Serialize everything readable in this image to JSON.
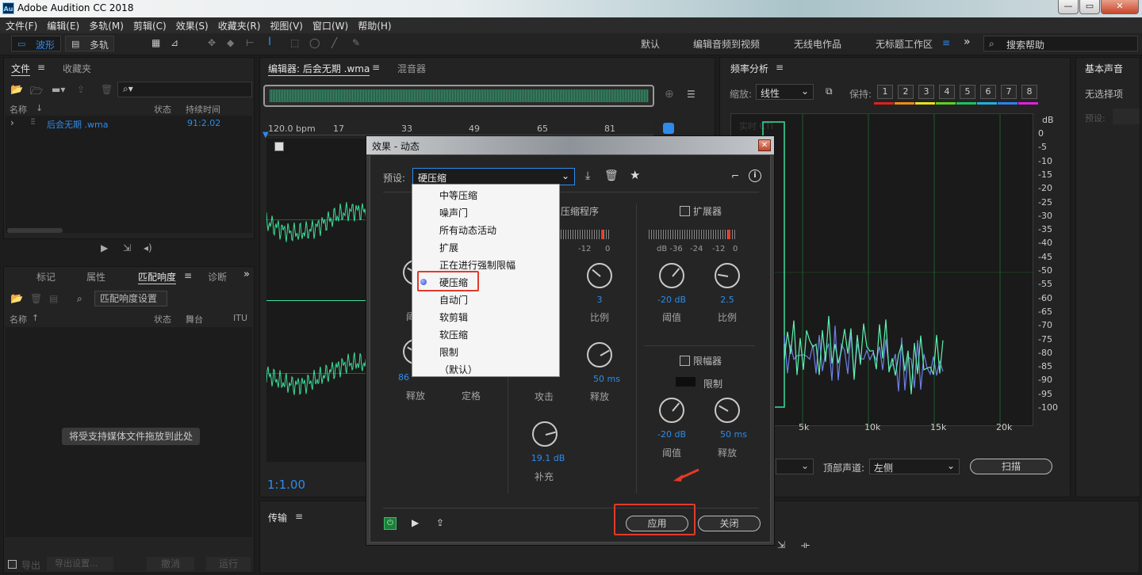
{
  "app": {
    "title": "Adobe Audition CC 2018",
    "logo": "Au"
  },
  "menu": [
    "文件(F)",
    "编辑(E)",
    "多轨(M)",
    "剪辑(C)",
    "效果(S)",
    "收藏夹(R)",
    "视图(V)",
    "窗口(W)",
    "帮助(H)"
  ],
  "toolbar": {
    "waveform": "波形",
    "multitrack": "多轨"
  },
  "workspaces": {
    "default": "默认",
    "edit_video": "编辑音频到视频",
    "radio": "无线电作品",
    "untitled": "无标题工作区",
    "more": "»",
    "search_placeholder": "搜索帮助"
  },
  "files_panel": {
    "tab_files": "文件",
    "tab_favorites": "收藏夹",
    "col_name": "名称",
    "col_status": "状态",
    "col_duration": "持续时间",
    "file_name": "后会无期 .wma",
    "file_duration": "91:2.02"
  },
  "markers_panel": {
    "tab_markers": "标记",
    "tab_props": "属性",
    "tab_match": "匹配响度",
    "tab_diag": "诊断",
    "match_settings": "匹配响度设置",
    "col_name": "名称",
    "col_status": "状态",
    "col_stage": "舞台",
    "col_itu": "ITU",
    "drop_hint": "将受支持媒体文件拖放到此处",
    "export": "导出",
    "export_settings": "导出设置...",
    "cancel": "撤消",
    "run": "运行"
  },
  "editor": {
    "tab_editor": "编辑器: 后会无期 .wma",
    "tab_mixer": "混音器",
    "bpm": "120.0 bpm",
    "ruler": [
      "17",
      "33",
      "49",
      "65",
      "81"
    ],
    "zoom": "1:1.00",
    "transport": "传输"
  },
  "freq_panel": {
    "title": "频率分析",
    "zoom_label": "缩放:",
    "zoom_value": "线性",
    "hold_label": "保持:",
    "hold_slots": [
      "1",
      "2",
      "3",
      "4",
      "5",
      "6",
      "7",
      "8"
    ],
    "hold_colors": [
      "#e02020",
      "#f08a18",
      "#e8e020",
      "#60d020",
      "#20c060",
      "#20b0e0",
      "#3080f0",
      "#e020e0"
    ],
    "realtime": "实时 CTI",
    "db_unit": "dB",
    "db_ticks": [
      "0",
      "-5",
      "-10",
      "-15",
      "-20",
      "-25",
      "-30",
      "-35",
      "-40",
      "-45",
      "-50",
      "-55",
      "-60",
      "-65",
      "-70",
      "-75",
      "-80",
      "-85",
      "-90",
      "-95",
      "-100"
    ],
    "hz_ticks": [
      "5k",
      "10k",
      "15k",
      "20k"
    ],
    "top_channel_label": "顶部声道:",
    "top_channel_value": "左侧",
    "scan": "扫描"
  },
  "essential_panel": {
    "title": "基本声音",
    "no_selection": "无选择项",
    "preset": "预设:"
  },
  "dialog": {
    "title": "效果 - 动态",
    "preset_label": "预设:",
    "preset_value": "硬压缩",
    "compressor_title": "压缩程序",
    "comp_meter_ticks": [
      "-12",
      "0"
    ],
    "ratio_value": "3",
    "ratio_label": "比例",
    "release_value": "50 ms",
    "release_label": "释放",
    "attack_label": "攻击",
    "makeup_value": "19.1 dB",
    "makeup_label": "补充",
    "left_threshold_label": "阈值",
    "left_release_value": "86",
    "left_release_label": "释放",
    "left_hold_label": "定格",
    "expander_title": "扩展器",
    "exp_meter_ticks": [
      "dB -36",
      "-24",
      "-12",
      "0"
    ],
    "exp_threshold_value": "-20 dB",
    "exp_threshold_label": "阈值",
    "exp_ratio_value": "2.5",
    "exp_ratio_label": "比例",
    "limiter_title": "限幅器",
    "limiter_limit": "限制",
    "lim_threshold_value": "-20 dB",
    "lim_threshold_label": "阈值",
    "lim_release_value": "50 ms",
    "lim_release_label": "释放",
    "apply": "应用",
    "close": "关闭"
  },
  "preset_dropdown": {
    "items": [
      "中等压缩",
      "噪声门",
      "所有动态活动",
      "扩展",
      "正在进行强制限幅",
      "硬压缩",
      "自动门",
      "软剪辑",
      "软压缩",
      "限制",
      "（默认）"
    ],
    "selected_index": 5
  },
  "colors": {
    "accent": "#2d8ceb",
    "waveform": "#3de09a",
    "highlight": "#e23a2a"
  }
}
